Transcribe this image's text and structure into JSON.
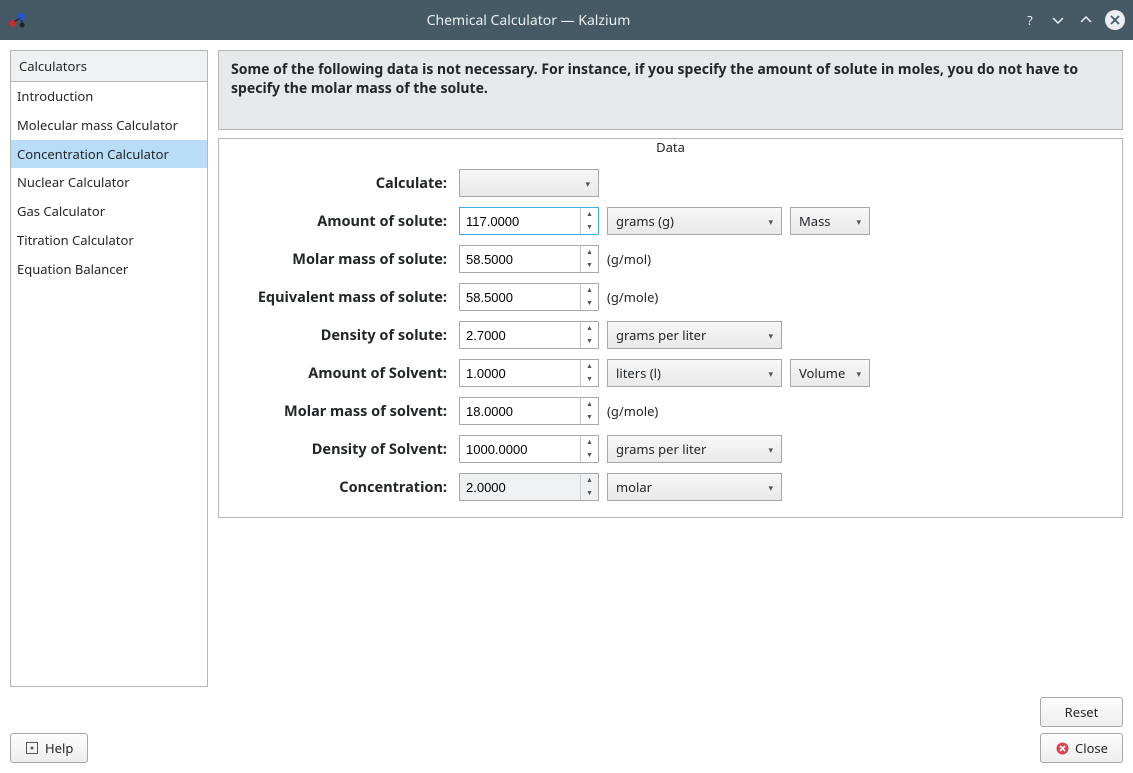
{
  "window": {
    "title": "Chemical Calculator — Kalzium"
  },
  "sidebar": {
    "header": "Calculators",
    "items": [
      "Introduction",
      "Molecular mass Calculator",
      "Concentration Calculator",
      "Nuclear Calculator",
      "Gas Calculator",
      "Titration Calculator",
      "Equation Balancer"
    ],
    "selected_index": 2
  },
  "info_banner": "Some of the following data is not necessary. For instance, if you specify the amount of solute in moles, you do not have to specify the molar mass of the solute.",
  "data_box": {
    "legend": "Data",
    "rows": {
      "calculate": {
        "label": "Calculate:",
        "value": ""
      },
      "amount_solute": {
        "label": "Amount of solute:",
        "value": "117.0000",
        "unit": "grams (g)",
        "mode": "Mass"
      },
      "molar_mass_solute": {
        "label": "Molar mass of solute:",
        "value": "58.5000",
        "suffix": "(g/mol)"
      },
      "equiv_mass_solute": {
        "label": "Equivalent mass of solute:",
        "value": "58.5000",
        "suffix": "(g/mole)"
      },
      "density_solute": {
        "label": "Density of solute:",
        "value": "2.7000",
        "unit": "grams per liter"
      },
      "amount_solvent": {
        "label": "Amount of Solvent:",
        "value": "1.0000",
        "unit": "liters (l)",
        "mode": "Volume"
      },
      "molar_mass_solvent": {
        "label": "Molar mass of solvent:",
        "value": "18.0000",
        "suffix": "(g/mole)"
      },
      "density_solvent": {
        "label": "Density of Solvent:",
        "value": "1000.0000",
        "unit": "grams per liter"
      },
      "concentration": {
        "label": "Concentration:",
        "value": "2.0000",
        "unit": "molar"
      }
    }
  },
  "buttons": {
    "help": "Help",
    "reset": "Reset",
    "close": "Close"
  }
}
